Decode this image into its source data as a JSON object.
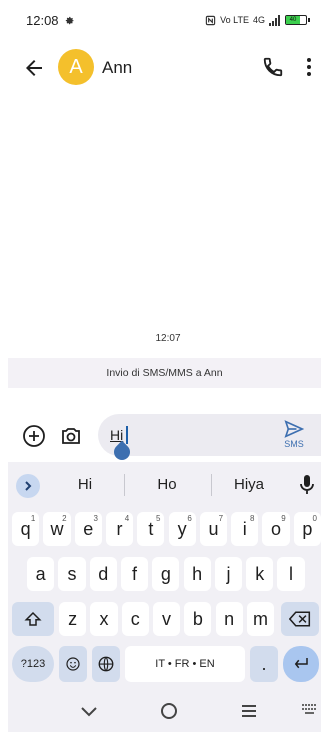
{
  "status_bar": {
    "time": "12:08",
    "network": "Vo LTE",
    "signal_label": "4G",
    "battery_level": "40"
  },
  "app_bar": {
    "avatar_letter": "A",
    "contact_name": "Ann"
  },
  "conversation": {
    "timestamp": "12:07",
    "banner": "Invio di SMS/MMS a Ann"
  },
  "compose": {
    "text": "Hi",
    "send_label": "SMS"
  },
  "keyboard": {
    "suggestions": [
      "Hi",
      "Ho",
      "Hiya"
    ],
    "row1": [
      {
        "k": "q",
        "h": "1"
      },
      {
        "k": "w",
        "h": "2"
      },
      {
        "k": "e",
        "h": "3"
      },
      {
        "k": "r",
        "h": "4"
      },
      {
        "k": "t",
        "h": "5"
      },
      {
        "k": "y",
        "h": "6"
      },
      {
        "k": "u",
        "h": "7"
      },
      {
        "k": "i",
        "h": "8"
      },
      {
        "k": "o",
        "h": "9"
      },
      {
        "k": "p",
        "h": "0"
      }
    ],
    "row2": [
      "a",
      "s",
      "d",
      "f",
      "g",
      "h",
      "j",
      "k",
      "l"
    ],
    "row3": [
      "z",
      "x",
      "c",
      "v",
      "b",
      "n",
      "m"
    ],
    "symbols_label": "?123",
    "space_label": "IT • FR • EN",
    "period_label": "."
  },
  "icons": {
    "back": "arrow-left-icon",
    "call": "phone-icon",
    "more": "more-vert-icon",
    "add": "add-circle-icon",
    "camera": "camera-icon",
    "send": "send-icon",
    "mic": "mic-icon",
    "shift": "shift-icon",
    "backspace": "backspace-icon",
    "emoji": "emoji-icon",
    "globe": "globe-icon",
    "enter": "enter-icon"
  },
  "colors": {
    "avatar": "#f4c02c",
    "accent": "#3d6fb0",
    "battery": "#3ccf4e"
  }
}
